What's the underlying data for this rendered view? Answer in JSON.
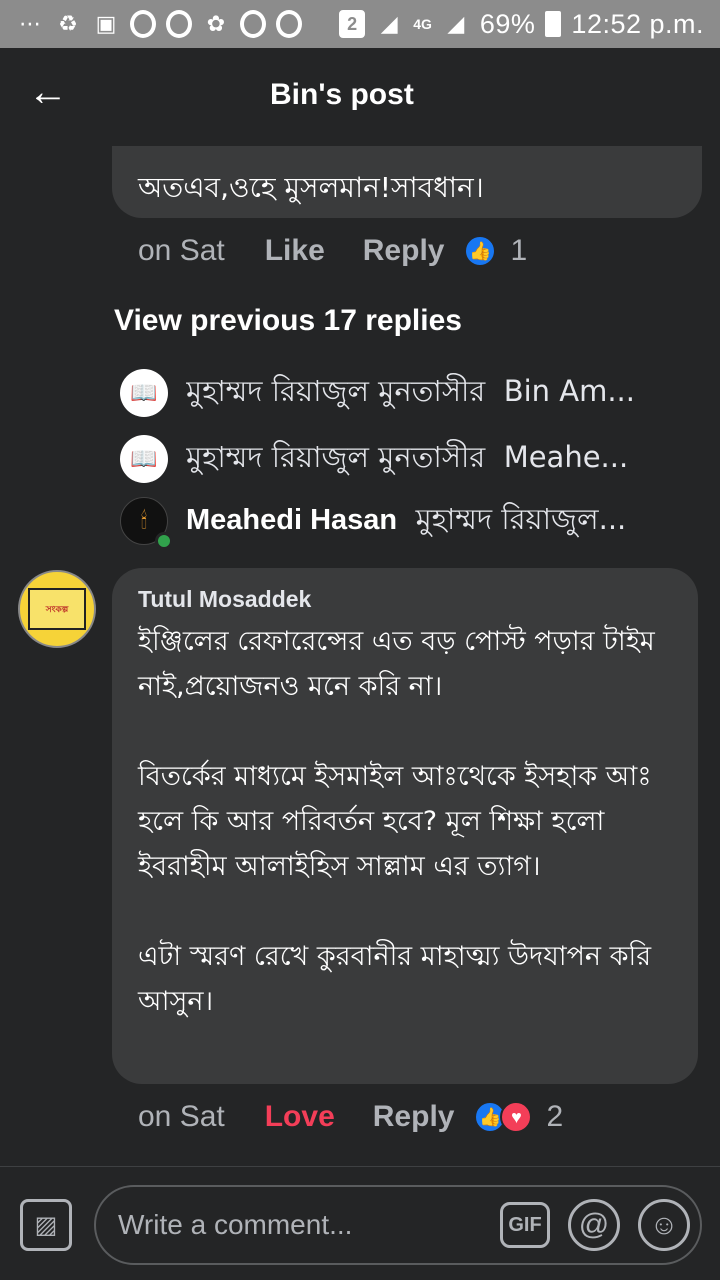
{
  "status_bar": {
    "sim_badge": "2",
    "network": "4G",
    "battery": "69%",
    "time": "12:52 p.m."
  },
  "header": {
    "back_icon": "back-arrow-icon",
    "title": "Bin's post"
  },
  "previous_comment": {
    "text_tail": "অতএব,ওহে মুসলমান!সাবধান।",
    "time": "on Sat",
    "like_label": "Like",
    "reply_label": "Reply",
    "reaction_count": "1"
  },
  "view_previous": "View previous 17 replies",
  "replies": [
    {
      "author": "মুহাম্মদ রিয়াজুল মুনতাসীর",
      "preview": "Bin Am...",
      "avatar": "book-icon",
      "bold": false
    },
    {
      "author": "মুহাম্মদ রিয়াজুল মুনতাসীর",
      "preview": "Meahe...",
      "avatar": "book-icon",
      "bold": false
    },
    {
      "author": "Meahedi Hasan",
      "preview": "মুহাম্মদ রিয়াজুল...",
      "avatar": "candle-icon",
      "bold": true
    }
  ],
  "comment": {
    "author": "Tutul Mosaddek",
    "paragraphs": [
      "ইঞ্জিলের রেফারেন্সের এত বড় পোস্ট পড়ার টাইম নাই,প্রয়োজনও মনে করি না।",
      "বিতর্কের মাধ্যমে ইসমাইল আঃথেকে ইসহাক আঃ হলে কি আর পরিবর্তন হবে? মূল শিক্ষা হলো ইবরাহীম আলাইহিস সাল্লাম এর ত্যাগ।",
      "এটা স্মরণ রেখে কুরবানীর মাহাত্ম্য উদযাপন করি আসুন।"
    ],
    "time": "on Sat",
    "love_label": "Love",
    "reply_label": "Reply",
    "reaction_count": "2",
    "colors": {
      "love": "#f33e58",
      "like": "#1877f2"
    }
  },
  "composer": {
    "placeholder": "Write a comment...",
    "gif_label": "GIF",
    "at_label": "@",
    "photo_icon": "photo-icon",
    "emoji_icon": "emoji-icon"
  }
}
